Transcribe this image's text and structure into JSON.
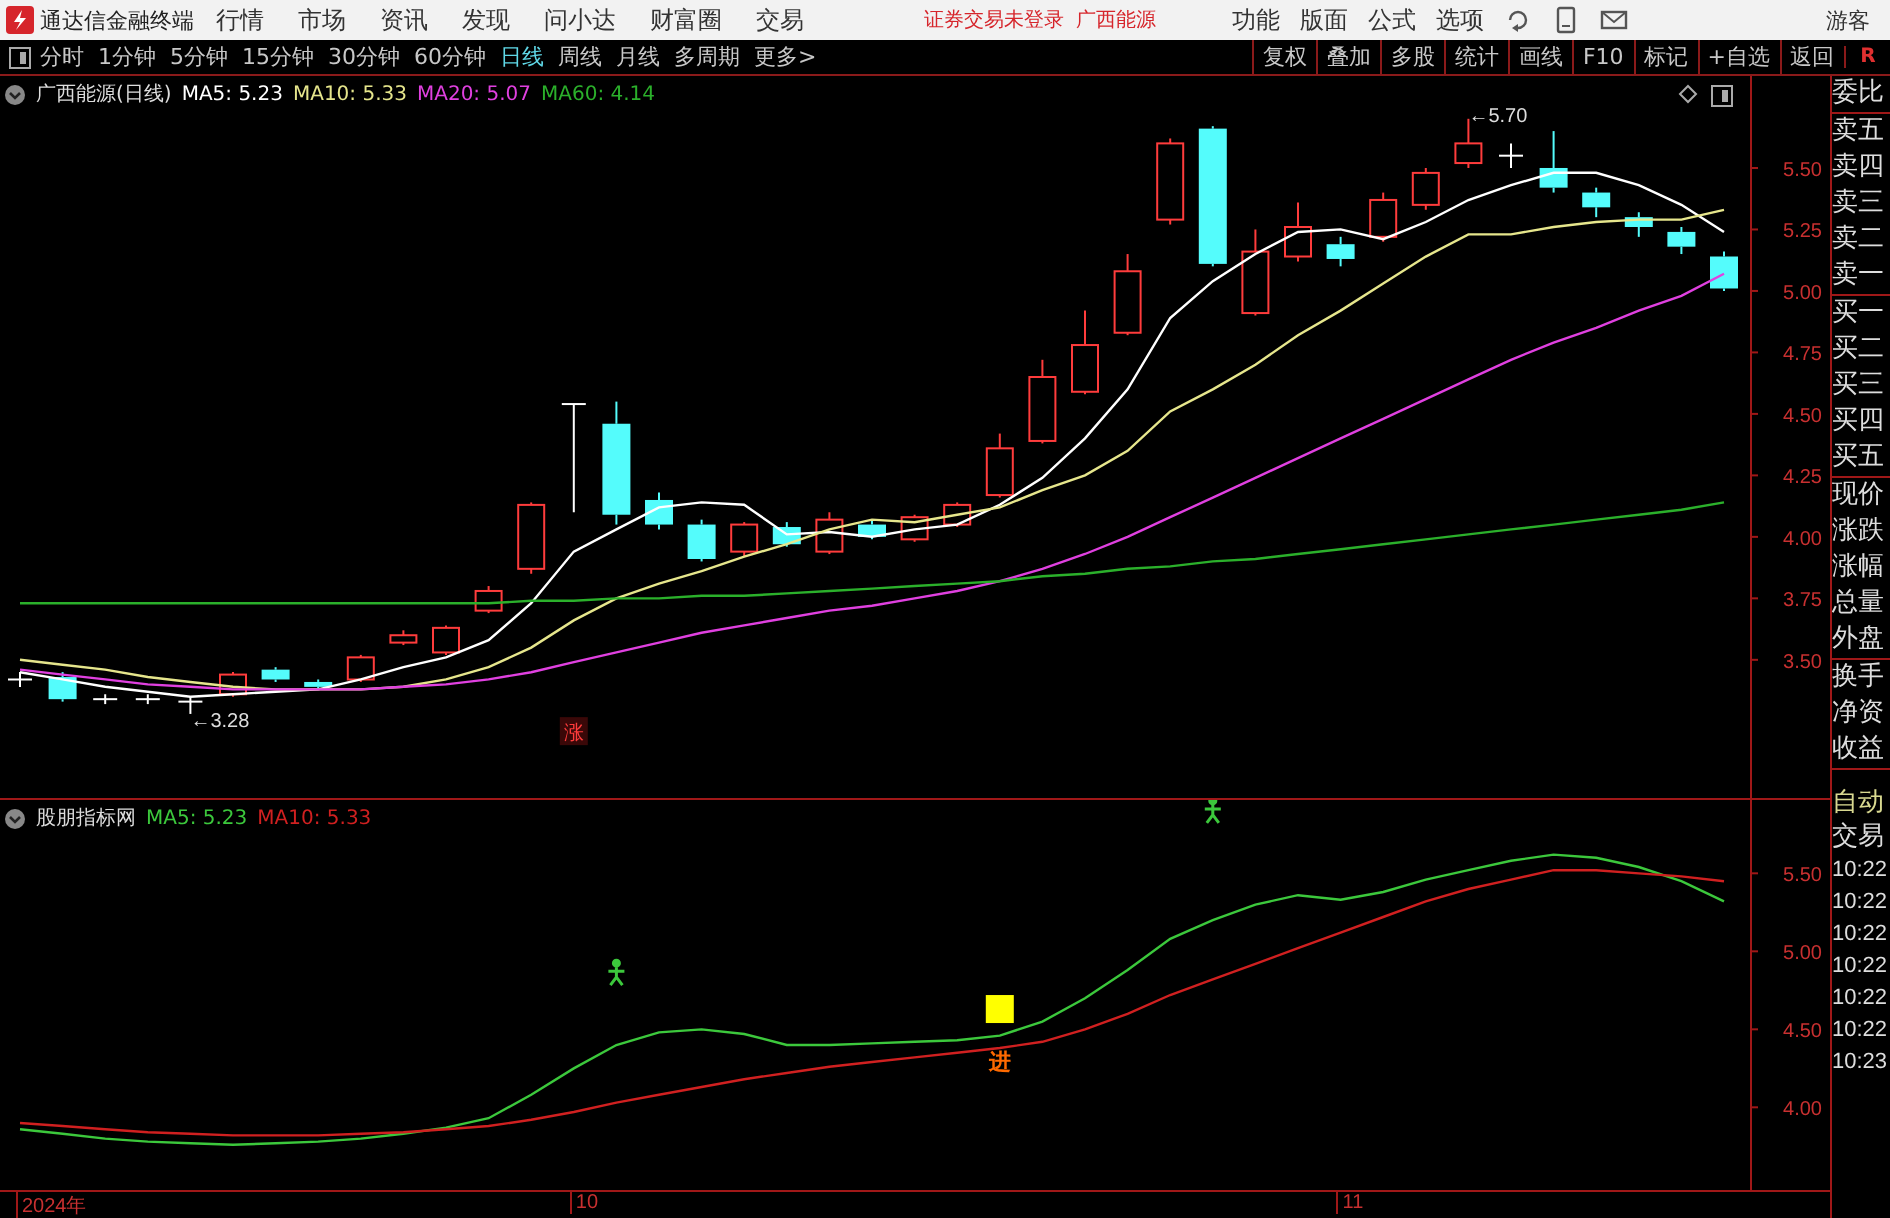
{
  "app": {
    "title": "通达信金融终端",
    "menu": [
      "行情",
      "市场",
      "资讯",
      "发现",
      "问小达",
      "财富圈",
      "交易"
    ],
    "status": "证券交易未登录",
    "stock": "广西能源",
    "tools": [
      "功能",
      "版面",
      "公式",
      "选项"
    ],
    "user": "游客"
  },
  "toolbar": {
    "periods": [
      {
        "label": "分时",
        "selected": false
      },
      {
        "label": "1分钟",
        "selected": false
      },
      {
        "label": "5分钟",
        "selected": false
      },
      {
        "label": "15分钟",
        "selected": false
      },
      {
        "label": "30分钟",
        "selected": false
      },
      {
        "label": "60分钟",
        "selected": false
      },
      {
        "label": "日线",
        "selected": true
      },
      {
        "label": "周线",
        "selected": false
      },
      {
        "label": "月线",
        "selected": false
      },
      {
        "label": "多周期",
        "selected": false
      },
      {
        "label": "更多>",
        "selected": false
      }
    ],
    "actions": [
      "复权",
      "叠加",
      "多股",
      "统计",
      "画线",
      "F10",
      "标记",
      "+自选",
      "返回"
    ],
    "corner": "R"
  },
  "price_panel": {
    "title": "广西能源(日线)",
    "legend": [
      {
        "text": "MA5: 5.23",
        "color": "#ffffff"
      },
      {
        "text": "MA10: 5.33",
        "color": "#e6e68c"
      },
      {
        "text": "MA20: 5.07",
        "color": "#e040e0"
      },
      {
        "text": "MA60: 4.14",
        "color": "#2bb02b"
      }
    ],
    "axis_labels": [
      "5.50",
      "5.25",
      "5.00",
      "4.75",
      "4.50",
      "4.25",
      "4.00",
      "3.75",
      "3.50"
    ],
    "high_label": "←5.70",
    "low_label": "←3.28",
    "rise_tag": "涨"
  },
  "indicator_panel": {
    "title": "股朋指标网",
    "legend": [
      {
        "text": "MA5: 5.23",
        "color": "#3cc83c"
      },
      {
        "text": "MA10: 5.33",
        "color": "#d02020"
      }
    ],
    "axis_labels": [
      "5.50",
      "5.00",
      "4.50",
      "4.00"
    ],
    "signal_label": "进"
  },
  "date_axis": [
    "2024年",
    "10",
    "11"
  ],
  "quote_panel": {
    "groups": [
      [
        "委比"
      ],
      [
        "卖五",
        "卖四",
        "卖三",
        "卖二",
        "卖一"
      ],
      [
        "买一",
        "买二",
        "买三",
        "买四",
        "买五"
      ],
      [
        "现价",
        "涨跌",
        "涨幅",
        "总量",
        "外盘"
      ],
      [
        "换手",
        "净资",
        "收益"
      ]
    ]
  },
  "trade_panel": {
    "tabs": [
      {
        "label": "自动",
        "selected": true
      },
      {
        "label": "交易",
        "selected": false
      }
    ],
    "times": [
      "10:22",
      "10:22",
      "10:22",
      "10:22",
      "10:22",
      "10:22",
      "10:23"
    ]
  }
}
